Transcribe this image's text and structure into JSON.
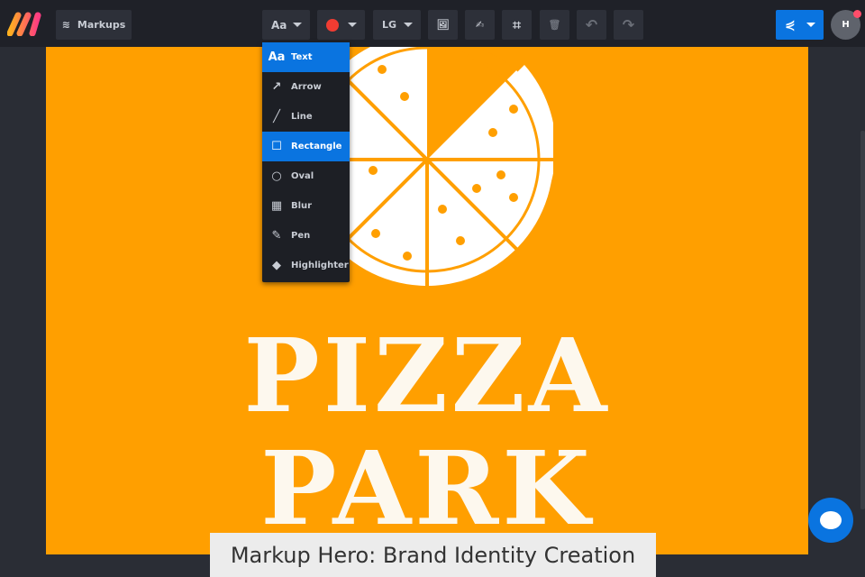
{
  "toolbar": {
    "markups_label": "Markups",
    "text_tool": "Aa",
    "size": "LG",
    "avatar": "H"
  },
  "menu": {
    "items": [
      {
        "icon": "Aa",
        "label": "Text",
        "active": true
      },
      {
        "icon": "↗",
        "label": "Arrow",
        "active": false
      },
      {
        "icon": "╱",
        "label": "Line",
        "active": false
      },
      {
        "icon": "☐",
        "label": "Rectangle",
        "active": true
      },
      {
        "icon": "○",
        "label": "Oval",
        "active": false
      },
      {
        "icon": "▦",
        "label": "Blur",
        "active": false
      },
      {
        "icon": "✎",
        "label": "Pen",
        "active": false
      },
      {
        "icon": "◆",
        "label": "Highlighter",
        "active": false
      }
    ]
  },
  "canvas": {
    "line1": "PIZZA",
    "line2": "PARK"
  },
  "caption": "Markup Hero: Brand Identity Creation",
  "colors": {
    "accent": "#0a74e0",
    "canvas": "#ff9f00",
    "color_swatch": "#f03c32"
  }
}
